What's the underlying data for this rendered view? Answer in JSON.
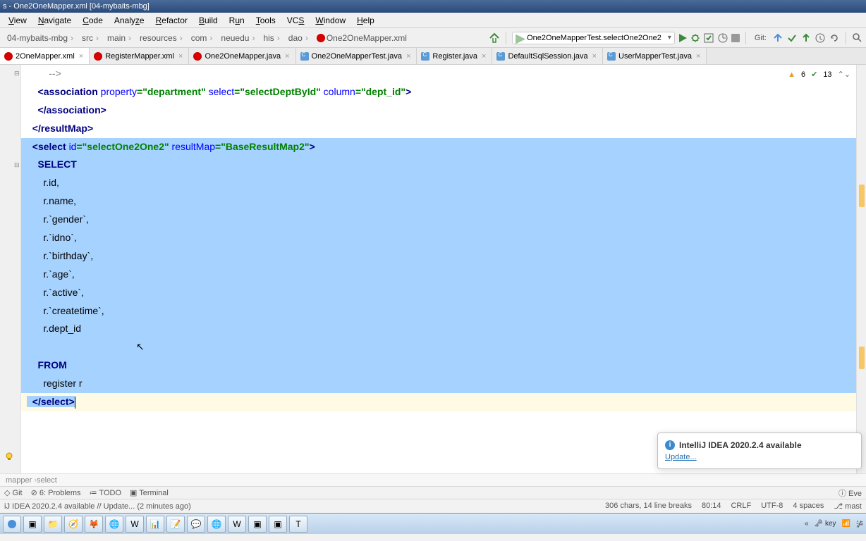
{
  "window": {
    "title": "s - One2OneMapper.xml [04-mybaits-mbg]"
  },
  "menu": [
    "View",
    "Navigate",
    "Code",
    "Analyze",
    "Refactor",
    "Build",
    "Run",
    "Tools",
    "VCS",
    "Window",
    "Help"
  ],
  "breadcrumb": [
    "04-mybaits-mbg",
    "src",
    "main",
    "resources",
    "com",
    "neuedu",
    "his",
    "dao",
    "One2OneMapper.xml"
  ],
  "run_config": "One2OneMapperTest.selectOne2One2",
  "git_label": "Git:",
  "tabs": [
    {
      "name": "2OneMapper.xml",
      "type": "xml",
      "active": true
    },
    {
      "name": "RegisterMapper.xml",
      "type": "xml",
      "active": false
    },
    {
      "name": "One2OneMapper.java",
      "type": "xml",
      "active": false
    },
    {
      "name": "One2OneMapperTest.java",
      "type": "java",
      "active": false
    },
    {
      "name": "Register.java",
      "type": "java",
      "active": false
    },
    {
      "name": "DefaultSqlSession.java",
      "type": "java",
      "active": false
    },
    {
      "name": "UserMapperTest.java",
      "type": "java",
      "active": false
    }
  ],
  "inspections": {
    "warn": "6",
    "ok": "13"
  },
  "code": {
    "l1": "        -->",
    "l2a": "    <",
    "l2b": "association ",
    "l2c": "property",
    "l2d": "=\"department\" ",
    "l2e": "select",
    "l2f": "=\"selectDeptById\" ",
    "l2g": "column",
    "l2h": "=\"dept_id\"",
    "l3": "",
    "l4": "    </association>",
    "l5": "  </resultMap>",
    "l6a": "  <",
    "l6b": "select ",
    "l6c": "id",
    "l6d": "=\"selectOne2One2\" ",
    "l6e": "resultMap",
    "l6f": "=\"BaseResultMap2\"",
    "l7": "    SELECT",
    "l8": "      r.id,",
    "l9": "      r.name,",
    "l10": "      r.`gender`,",
    "l11": "      r.`idno`,",
    "l12": "      r.`birthday`,",
    "l13": "      r.`age`,",
    "l14": "      r.`active`,",
    "l15": "      r.`createtime`,",
    "l16": "      r.dept_id",
    "l17": "",
    "l18": "    FROM",
    "l19": "      register r",
    "l20": "  </select>"
  },
  "breadcrumb2": [
    "mapper",
    "select"
  ],
  "toolwindows": {
    "git": "Git",
    "problems": "6: Problems",
    "todo": "TODO",
    "terminal": "Terminal",
    "event": "Eve"
  },
  "status": {
    "left": "iJ IDEA 2020.2.4 available // Update... (2 minutes ago)",
    "chars": "306 chars, 14 line breaks",
    "pos": "80:14",
    "eol": "CRLF",
    "enc": "UTF-8",
    "indent": "4 spaces",
    "branch": "mast"
  },
  "notification": {
    "title": "IntelliJ IDEA 2020.2.4 available",
    "link": "Update..."
  },
  "tray": {
    "key": "key",
    "net": "泸"
  }
}
